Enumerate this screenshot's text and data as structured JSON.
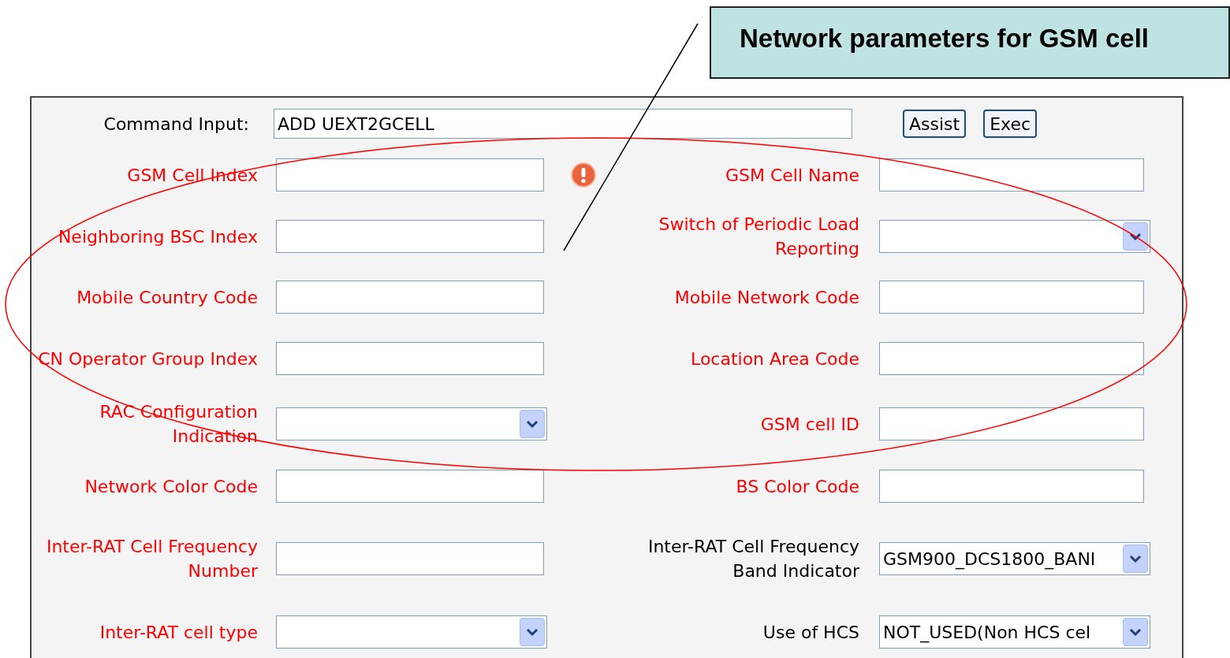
{
  "callout": {
    "text": "Network parameters for GSM cell"
  },
  "command": {
    "label": "Command Input:",
    "value": "ADD UEXT2GCELL"
  },
  "buttons": [
    "Assist",
    "Exec"
  ],
  "rows": [
    {
      "left": {
        "label": "GSM Cell Index",
        "kind": "text",
        "required": true,
        "error": true
      },
      "right": {
        "label": "GSM Cell Name",
        "kind": "text",
        "required": true
      }
    },
    {
      "left": {
        "label": "Neighboring BSC Index",
        "kind": "text",
        "required": true
      },
      "right": {
        "label": "Switch of Periodic Load Reporting",
        "kind": "select",
        "required": true
      }
    },
    {
      "left": {
        "label": "Mobile Country Code",
        "kind": "text",
        "required": true
      },
      "right": {
        "label": "Mobile Network Code",
        "kind": "text",
        "required": true
      }
    },
    {
      "left": {
        "label": "CN Operator Group Index",
        "kind": "text",
        "required": true
      },
      "right": {
        "label": "Location Area Code",
        "kind": "text",
        "required": true
      }
    },
    {
      "left": {
        "label": "RAC Configuration Indication",
        "kind": "select",
        "required": true
      },
      "right": {
        "label": "GSM cell ID",
        "kind": "text",
        "required": true
      }
    },
    {
      "left": {
        "label": "Network Color Code",
        "kind": "text",
        "required": true
      },
      "right": {
        "label": "BS Color Code",
        "kind": "text",
        "required": true
      }
    },
    {
      "left": {
        "label": "Inter-RAT Cell Frequency Number",
        "kind": "text",
        "required": true
      },
      "right": {
        "label": "Inter-RAT Cell Frequency Band Indicator",
        "kind": "select",
        "required": false,
        "value": "GSM900_DCS1800_BANI"
      }
    },
    {
      "left": {
        "label": "Inter-RAT cell type",
        "kind": "select",
        "required": true
      },
      "right": {
        "label": "Use of HCS",
        "kind": "select",
        "required": false,
        "value": "NOT_USED(Non HCS cel"
      }
    }
  ]
}
